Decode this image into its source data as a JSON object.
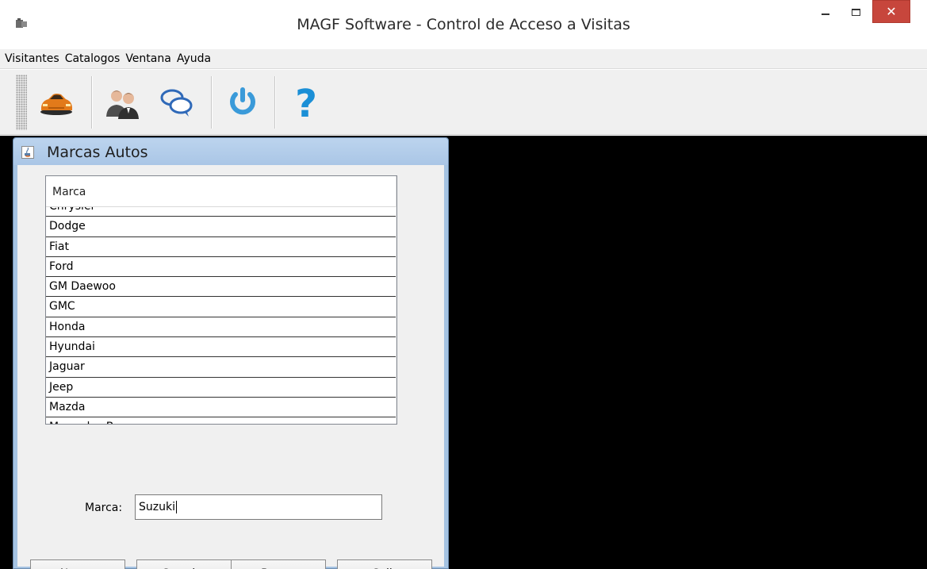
{
  "window": {
    "title": "MAGF Software - Control de Acceso a Visitas",
    "close_glyph": "✕"
  },
  "menu": {
    "items": [
      "Visitantes",
      "Catalogos",
      "Ventana",
      "Ayuda"
    ]
  },
  "toolbar": {
    "buttons": [
      {
        "icon": "car-icon"
      },
      {
        "icon": "users-icon"
      },
      {
        "icon": "chat-bubbles-icon"
      },
      {
        "icon": "power-icon"
      },
      {
        "icon": "help-icon"
      }
    ],
    "help_glyph": "?"
  },
  "frame": {
    "title": "Marcas Autos",
    "table": {
      "header": "Marca",
      "rows": [
        "Chrysler",
        "Dodge",
        "Fiat",
        "Ford",
        "GM Daewoo",
        "GMC",
        "Honda",
        "Hyundai",
        "Jaguar",
        "Jeep",
        "Mazda",
        "Mercedes Benz"
      ]
    },
    "form": {
      "label": "Marca:",
      "value": "Suzuki"
    },
    "buttons": {
      "nuevo": {
        "mnemonic": "N",
        "rest": "uevo"
      },
      "guardar": {
        "mnemonic": "G",
        "rest": "uardar"
      },
      "borrar": {
        "mnemonic": "B",
        "rest": "orrar"
      },
      "salir": {
        "mnemonic": "S",
        "rest": "alir"
      }
    }
  },
  "colors": {
    "frame_border": "#a5c3e2",
    "close_button": "#c7463c",
    "desktop": "#000000",
    "power_icon": "#3a9ad9",
    "help_icon": "#1b8fd6"
  }
}
